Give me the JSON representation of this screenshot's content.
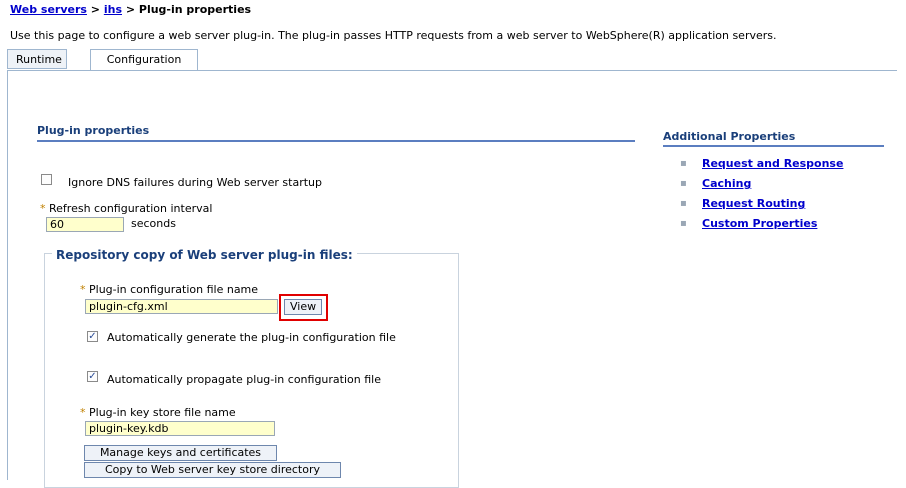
{
  "breadcrumb": {
    "level1": "Web servers",
    "sep1": " > ",
    "level2": "ihs",
    "sep2": " > ",
    "current": "Plug-in properties"
  },
  "description": "Use this page to configure a web server plug-in. The plug-in passes HTTP requests from a web server to WebSphere(R) application servers.",
  "tabs": [
    {
      "label": "Runtime",
      "active": false
    },
    {
      "label": "Configuration",
      "active": true
    }
  ],
  "plugin_properties": {
    "title": "Plug-in properties",
    "ignore_dns_label": "Ignore DNS failures during Web server startup",
    "ignore_dns_checked": false,
    "refresh_label": "Refresh configuration interval",
    "refresh_value": "60",
    "refresh_unit": "seconds"
  },
  "repository": {
    "legend": "Repository copy of Web server plug-in files:",
    "config_file_label": "Plug-in configuration file name",
    "config_file_value": "plugin-cfg.xml",
    "view_button": "View",
    "auto_generate_label": "Automatically generate the plug-in configuration file",
    "auto_generate_checked": true,
    "auto_propagate_label": "Automatically propagate plug-in configuration file",
    "auto_propagate_checked": true,
    "keystore_label": "Plug-in key store file name",
    "keystore_value": "plugin-key.kdb",
    "manage_keys_button": "Manage keys and certificates",
    "copy_keystore_button": "Copy to Web server key store directory"
  },
  "additional_properties": {
    "title": "Additional Properties",
    "links": [
      "Request and Response",
      "Caching",
      "Request Routing",
      "Custom Properties"
    ]
  },
  "required_marker": "*",
  "checkmark": "✓",
  "bullet": "▪",
  "colors": {
    "link": "#0000cc",
    "section_title": "#1a3f7a",
    "input_bg": "#ffffcc",
    "highlight": "#e00000"
  }
}
